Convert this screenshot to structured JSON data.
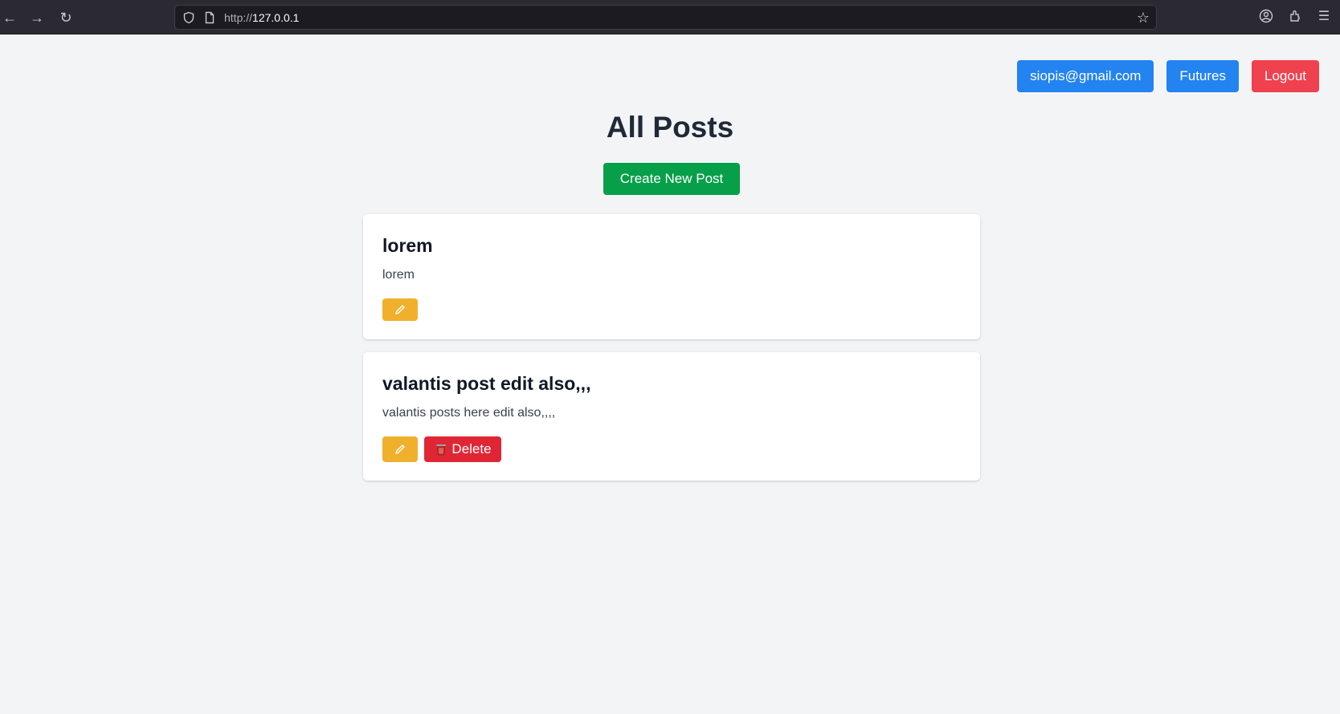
{
  "browser": {
    "url_protocol": "http://",
    "url_host": "127.0.0.1"
  },
  "header": {
    "email_label": "siopis@gmail.com",
    "futures_label": "Futures",
    "logout_label": "Logout"
  },
  "page": {
    "title": "All Posts",
    "create_label": "Create New Post"
  },
  "posts": [
    {
      "title": "lorem",
      "body": "lorem"
    },
    {
      "title": "valantis post edit also,,,",
      "body": "valantis posts here edit also,,,,",
      "delete_label": "Delete"
    }
  ],
  "colors": {
    "primary": "#2383f0",
    "danger": "#f0414e",
    "success": "#079f4a",
    "warning": "#f0b02c"
  }
}
